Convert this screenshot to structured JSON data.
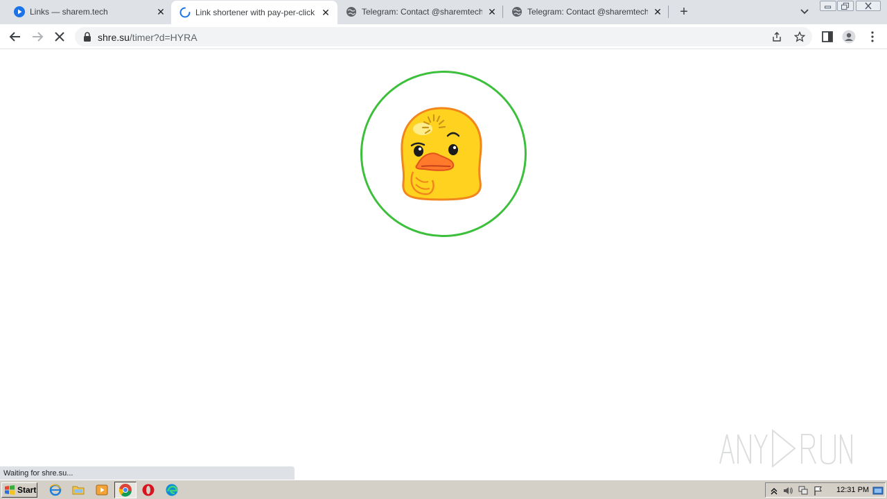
{
  "tabs": [
    {
      "title": "Links — sharem.tech",
      "icon": "blue-play-icon"
    },
    {
      "title": "Link shortener with pay-per-click",
      "icon": "loading-spinner-icon"
    },
    {
      "title": "Telegram: Contact @sharemtech_ne",
      "icon": "globe-icon"
    },
    {
      "title": "Telegram: Contact @sharemtech_ne",
      "icon": "globe-icon"
    }
  ],
  "address": {
    "host": "shre.su",
    "path": "/timer?d=HYRA"
  },
  "status_text": "Waiting for shre.su...",
  "timer": {
    "ring_color": "#3cc03c"
  },
  "watermark": "ANY RUN",
  "taskbar": {
    "start_label": "Start",
    "clock": "12:31 PM"
  }
}
